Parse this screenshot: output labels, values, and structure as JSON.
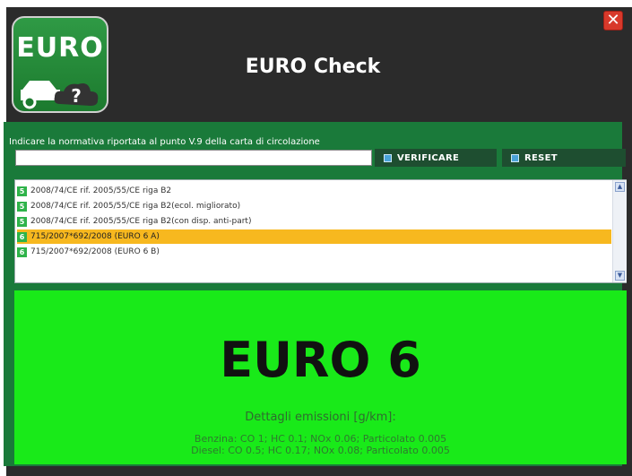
{
  "window": {
    "title": "EURO Check",
    "close_label": "✕",
    "logo_text": "EURO"
  },
  "form": {
    "instruction": "Indicare la normativa riportata al punto V.9 della carta di circolazione",
    "search_value": "",
    "verify_label": "VERIFICARE",
    "reset_label": "RESET"
  },
  "list": {
    "items": [
      {
        "badge": "5",
        "label": "2008/74/CE rif. 2005/55/CE riga B2",
        "selected": false
      },
      {
        "badge": "5",
        "label": "2008/74/CE rif. 2005/55/CE riga B2(ecol. migliorato)",
        "selected": false
      },
      {
        "badge": "5",
        "label": "2008/74/CE rif. 2005/55/CE riga B2(con disp. anti-part)",
        "selected": false
      },
      {
        "badge": "6",
        "label": "715/2007*692/2008 (EURO 6 A)",
        "selected": true
      },
      {
        "badge": "6",
        "label": "715/2007*692/2008 (EURO 6 B)",
        "selected": false
      }
    ]
  },
  "result": {
    "euro_class": "EURO 6",
    "heading": "Dettagli emissioni [g/km]:",
    "benzina": "Benzina: CO 1; HC 0.1; NOx 0.06; Particolato 0.005",
    "diesel": "Diesel: CO 0.5; HC 0.17; NOx 0.08; Particolato 0.005"
  },
  "colors": {
    "result_bg": "#19ea19",
    "selected_row": "#f7b81f",
    "panel_bg": "#1a7a3a"
  }
}
